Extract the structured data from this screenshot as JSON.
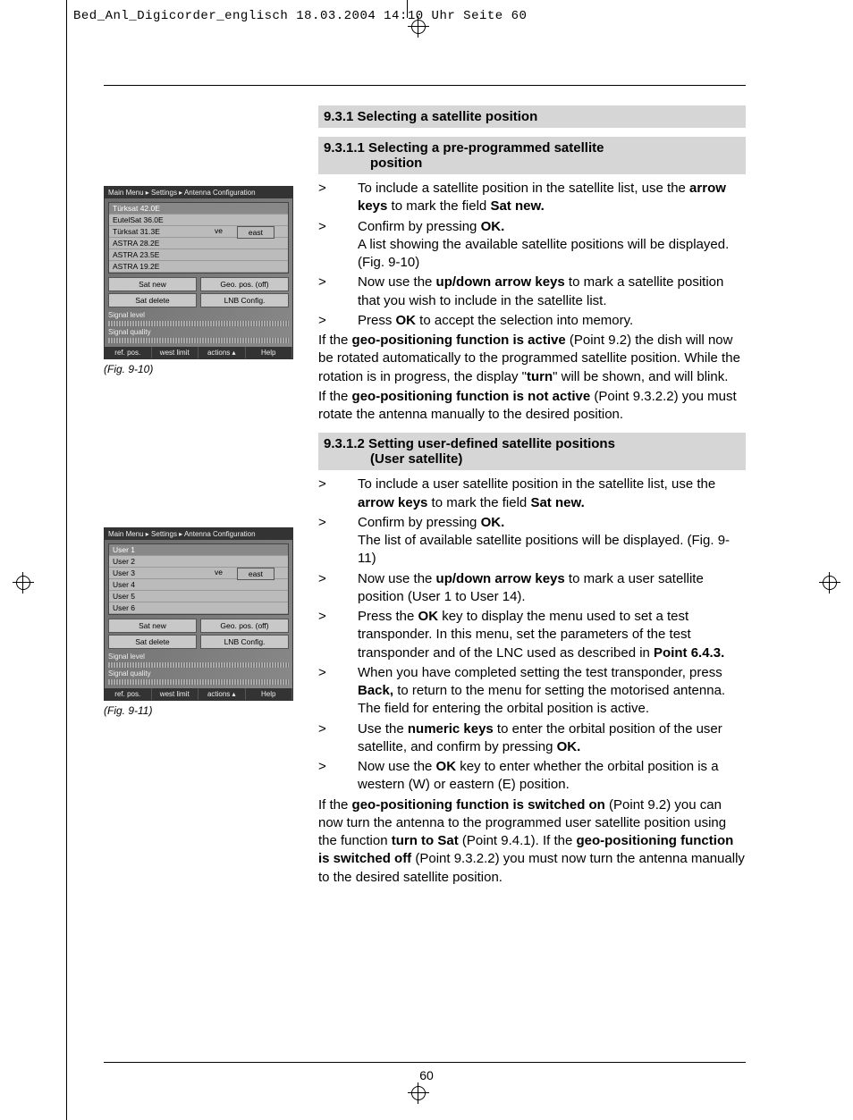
{
  "header": "Bed_Anl_Digicorder_englisch  18.03.2004  14:10 Uhr  Seite 60",
  "page_number": "60",
  "headings": {
    "h931": "9.3.1 Selecting a satellite position",
    "h9311_l1": "9.3.1.1 Selecting a pre-programmed satellite",
    "h9311_l2": "position",
    "h9312_l1": "9.3.1.2 Setting user-defined satellite positions",
    "h9312_l2": "(User satellite)"
  },
  "sec1": {
    "s1a": "To include a satellite position in the satellite list, use the ",
    "s1b": "arrow keys",
    "s1c": " to mark the field ",
    "s1d": "Sat new.",
    "s2a": "Confirm by pressing ",
    "s2b": "OK.",
    "s2c": "A list showing the available satellite positions will be displayed. (Fig. 9-10)",
    "s3a": "Now use the ",
    "s3b": "up/down arrow keys",
    "s3c": " to mark a satellite position that you wish to include in the satellite list.",
    "s4a": "Press ",
    "s4b": "OK",
    "s4c": " to accept the selection into memory.",
    "p1a": "If the ",
    "p1b": "geo-positioning function is active",
    "p1c": " (Point 9.2) the dish will now be rotated automatically to the programmed satellite position. While the rotation is in progress, the display \"",
    "p1d": "turn",
    "p1e": "\" will be shown, and will blink.",
    "p2a": "If the ",
    "p2b": "geo-positioning function is not active",
    "p2c": " (Point 9.3.2.2) you must rotate the antenna manually to the desired position."
  },
  "sec2": {
    "s1a": "To include a user satellite position in the satellite list, use the ",
    "s1b": "arrow keys",
    "s1c": " to mark the field ",
    "s1d": "Sat new.",
    "s2a": "Confirm by pressing ",
    "s2b": "OK.",
    "s2c": "The list of available satellite positions will be displayed. (Fig. 9-11)",
    "s3a": "Now use the ",
    "s3b": "up/down arrow keys",
    "s3c": " to mark a user satellite position (User 1 to User 14).",
    "s4a": "Press the ",
    "s4b": "OK",
    "s4c": " key to display the menu used to set a test transponder. In this menu, set the parameters of the test transponder and of the LNC used as described in ",
    "s4d": "Point 6.4.3.",
    "s5a": "When you have completed setting the test transponder, press ",
    "s5b": "Back,",
    "s5c": " to return to the menu for setting the motorised antenna. The field for entering the orbital position is active.",
    "s6a": "Use the ",
    "s6b": "numeric keys",
    "s6c": " to enter the orbital position of the user satellite, and confirm by pressing ",
    "s6d": "OK.",
    "s7a": "Now use the ",
    "s7b": "OK",
    "s7c": " key to enter whether the orbital position is a western (W) or eastern (E) position.",
    "p1a": "If the ",
    "p1b": "geo-positioning function is switched on",
    "p1c": " (Point 9.2) you can now turn the antenna to the programmed user satellite position using the function ",
    "p1d": "turn to Sat",
    "p1e": " (Point 9.4.1). If the ",
    "p1f": "geo-positioning function is switched off",
    "p1g": " (Point 9.3.2.2) you must now turn the antenna manually to the desired satellite position."
  },
  "fig1": {
    "caption": "(Fig. 9-10)",
    "crumb": "Main Menu ▸ Settings ▸ Antenna Configuration",
    "list": [
      "Türksat 42.0E",
      "EutelSat 36.0E",
      "Türksat 31.3E",
      "ASTRA 28.2E",
      "ASTRA 23.5E",
      "ASTRA 19.2E"
    ],
    "ve": "ve",
    "east": "east",
    "satnew": "Sat new",
    "geo": "Geo. pos. (off)",
    "satdel": "Sat delete",
    "lnb": "LNB Config.",
    "siglvl": "Signal level",
    "sigq": "Signal quality",
    "foot": [
      "ref. pos.",
      "west limit",
      "actions ▴",
      "Help"
    ]
  },
  "fig2": {
    "caption": "(Fig. 9-11)",
    "crumb": "Main Menu ▸ Settings ▸ Antenna Configuration",
    "list": [
      "User 1",
      "User 2",
      "User 3",
      "User 4",
      "User 5",
      "User 6"
    ],
    "ve": "ve",
    "east": "east",
    "satnew": "Sat new",
    "geo": "Geo. pos. (off)",
    "satdel": "Sat delete",
    "lnb": "LNB Config.",
    "siglvl": "Signal level",
    "sigq": "Signal quality",
    "foot": [
      "ref. pos.",
      "west limit",
      "actions ▴",
      "Help"
    ]
  }
}
